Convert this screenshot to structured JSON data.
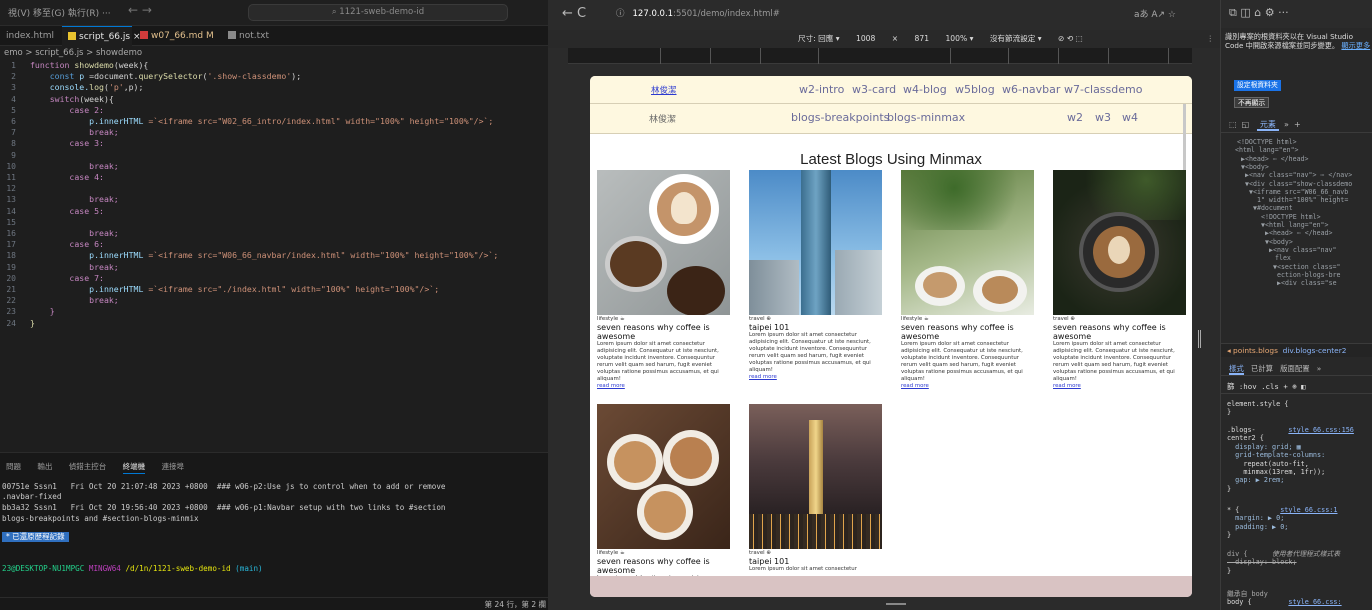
{
  "vscode": {
    "menu": "視(V)  移至(G)  執行(R)   ···",
    "nav": "←  →",
    "search": "1121-sweb-demo-id",
    "tabs": [
      "index.html",
      "script_66.js",
      "×",
      "w07_66.md M",
      "not.txt"
    ],
    "breadcrumb": "emo > script_66.js > showdemo",
    "line_numbers": [
      "1",
      "2",
      "3",
      "4",
      "5",
      "6",
      "7",
      "8",
      "9",
      "10",
      "11",
      "12",
      "13",
      "14",
      "15",
      "16",
      "17",
      "18",
      "19",
      "20",
      "21",
      "22",
      "23",
      "24"
    ],
    "code": {
      "l1a": "function ",
      "l1b": "showdemo",
      "l1c": "(week){",
      "l2a": "    const ",
      "l2b": "p ",
      "l2c": "=document.",
      "l2d": "querySelector",
      "l2e": "(",
      "l2f": "'.show-classdemo'",
      "l2g": ");",
      "l3a": "    console.",
      "l3b": "log",
      "l3c": "(",
      "l3d": "'p'",
      "l3e": ",p);",
      "l4a": "    switch",
      "l4b": "(week){",
      "l5": "        case 2:",
      "l6a": "            p.innerHTML ",
      "l6b": "=`<iframe src=\"W02_66_intro/index.html\" width=\"100%\" height=\"100%\"/>`;",
      "l7": "            break;",
      "l8": "        case 3:",
      "l10": "            break;",
      "l11": "        case 4:",
      "l13": "            break;",
      "l14": "        case 5:",
      "l16": "            break;",
      "l17": "        case 6:",
      "l18a": "            p.innerHTML ",
      "l18b": "=`<iframe src=\"W06_66_navbar/index.html\" width=\"100%\" height=\"100%\"/>`;",
      "l19": "            break;",
      "l20": "        case 7:",
      "l21a": "            p.innerHTML ",
      "l21b": "=`<iframe src=\"./index.html\" width=\"100%\" height=\"100%\"/>`;",
      "l22": "            break;",
      "l23": "    }",
      "l24": "}"
    },
    "panel_tabs": [
      "問題",
      "輸出",
      "偵錯主控台",
      "終端機",
      "連接埠"
    ],
    "terminal": [
      "00751e Sssn1   Fri Oct 20 21:07:48 2023 +0800  ### w06-p2:Use js to control when to add or remove",
      ".navbar-fixed",
      "bb3a32 Sssn1   Fri Oct 20 19:56:40 2023 +0800  ### w06-p1:Navbar setup with two links to #section",
      "blogs-breakpoints and #section-blogs-minmix"
    ],
    "terminal_button": "* 已還原歷程記錄",
    "prompt_user": "23@DESKTOP-NU1MPGC",
    "prompt_env": " MINGW64 ",
    "prompt_path": "/d/1n/1121-sweb-demo-id",
    "prompt_branch": " (main)",
    "status_right": "第 24 行，第 2 欄"
  },
  "browser": {
    "nav": "←  C",
    "url_icon": "ⓘ",
    "url_host": "127.0.0.1",
    "url_path": ":5501/demo/index.html#",
    "right_icons": "aあ  A↗  ☆",
    "devbar": [
      "尺寸: 回應 ▾",
      "1008",
      "×",
      "871",
      "100% ▾",
      "沒有節流設定 ▾",
      "⊘  ⟲  ⬚"
    ],
    "devbar_dots": "⋮",
    "nav1": {
      "brand": "林俊潔",
      "links": [
        "w2-intro",
        "w3-card",
        "w4-blog",
        "w5blog",
        "w6-navbar",
        "w7-classdemo"
      ]
    },
    "nav2": {
      "brand": "林俊潔",
      "links": [
        "blogs-breakpoints",
        "blogs-minmax"
      ],
      "right_links": [
        "w2",
        "w3",
        "w4"
      ]
    },
    "blog_title": "Latest Blogs Using Minmax",
    "lorem": "Lorem ipsum dolor sit amet consectetur adipisicing elit. Consequatur ut iste nesciunt, voluptate incidunt inventore. Consequuntur rerum velit quam sed harum, fugit eveniet voluptas ratione possimus accusamus, et qui aliquam!",
    "lorem_short": "Lorem ipsum dolor sit amet consectetur",
    "read_more": "read more",
    "cards": [
      {
        "cat": "lifestyle ☕",
        "title": "seven reasons why coffee is awesome"
      },
      {
        "cat": "travel ⊕",
        "title": "taipei 101"
      },
      {
        "cat": "lifestyle ☕",
        "title": "seven reasons why coffee is awesome"
      },
      {
        "cat": "travel ⊕",
        "title": "seven reasons why coffee is awesome"
      },
      {
        "cat": "lifestyle ☕",
        "title": "seven reasons why coffee is awesome"
      },
      {
        "cat": "travel ⊕",
        "title": "taipei 101"
      }
    ]
  },
  "devtools": {
    "top_icons": "⧉  ◫  ⌂  ⚙  ···",
    "notice": "識別專案的根資料夾以在 Visual Studio Code 中開啟來源檔案並同步變更。",
    "notice_link": "顯示更多",
    "btn1": "設定根資料夾",
    "btn2": "不再顯示",
    "tabs": [
      "⬚",
      "◱",
      "元素",
      "»",
      "+"
    ],
    "dom_lines": [
      "<!DOCTYPE html>",
      "<html lang=\"en\">",
      "▶<head> ⋯ </head>",
      "▼<body>",
      "▶<nav class=\"nav\"> ⋯ </nav>",
      "▼<div class=\"show-classdemo",
      "▼<iframe src=\"W06_66_navb",
      "1\" width=\"100%\" height=",
      "▼#document",
      "<!DOCTYPE html>",
      "▼<html lang=\"en\">",
      "▶<head> ⋯ </head>",
      "▼<body>",
      "▶<nav class=\"nav\"",
      "flex",
      "▼<section class=\"",
      "ection-blogs-bre",
      "▶<div class=\"se"
    ],
    "path_a": "◂ points.blogs",
    "path_b": "div.blogs-center2",
    "style_tabs": [
      "樣式",
      "已計算",
      "版面配置",
      "»"
    ],
    "filter": "篩    :hov  .cls  +  ⊕  ◧",
    "css": {
      "element": "element.style {",
      "close": "}",
      "sel1": ".blogs-",
      "src1": "style_66.css:156",
      "sel1b": "center2 {",
      "p1": "  display: grid; ▦",
      "p2": "  grid-template-columns:",
      "p3": "    repeat(auto-fit,",
      "p4": "    minmax(13rem, 1fr));",
      "p5": "  gap: ▶ 2rem;",
      "sel2": "* {",
      "src2": "style_66.css:1",
      "p6": "  margin: ▶ 0;",
      "p7": "  padding: ▶ 0;",
      "sel3": "div {",
      "ua": "使用者代理程式樣式表",
      "p8": "  display: block;",
      "inherit": "繼承自 body",
      "sel4": "body {",
      "src4": "style_66.css:"
    }
  }
}
